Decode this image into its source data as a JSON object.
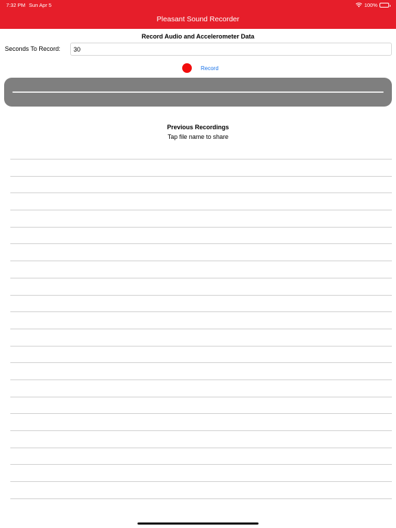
{
  "status_bar": {
    "time": "7:32 PM",
    "date": "Sun Apr 5",
    "battery": "100%"
  },
  "nav": {
    "title": "Pleasant Sound Recorder"
  },
  "recorder": {
    "section_title": "Record Audio and Accelerometer Data",
    "seconds_label": "Seconds To Record:",
    "seconds_value": "30",
    "record_label": "Record",
    "level": 0
  },
  "recordings": {
    "title": "Previous Recordings",
    "subtitle": "Tap file name to share",
    "items": []
  },
  "colors": {
    "header": "#e61e2a",
    "record_dot": "#f20d0d",
    "link": "#1a73e8",
    "level_panel": "#7f7f7f"
  }
}
